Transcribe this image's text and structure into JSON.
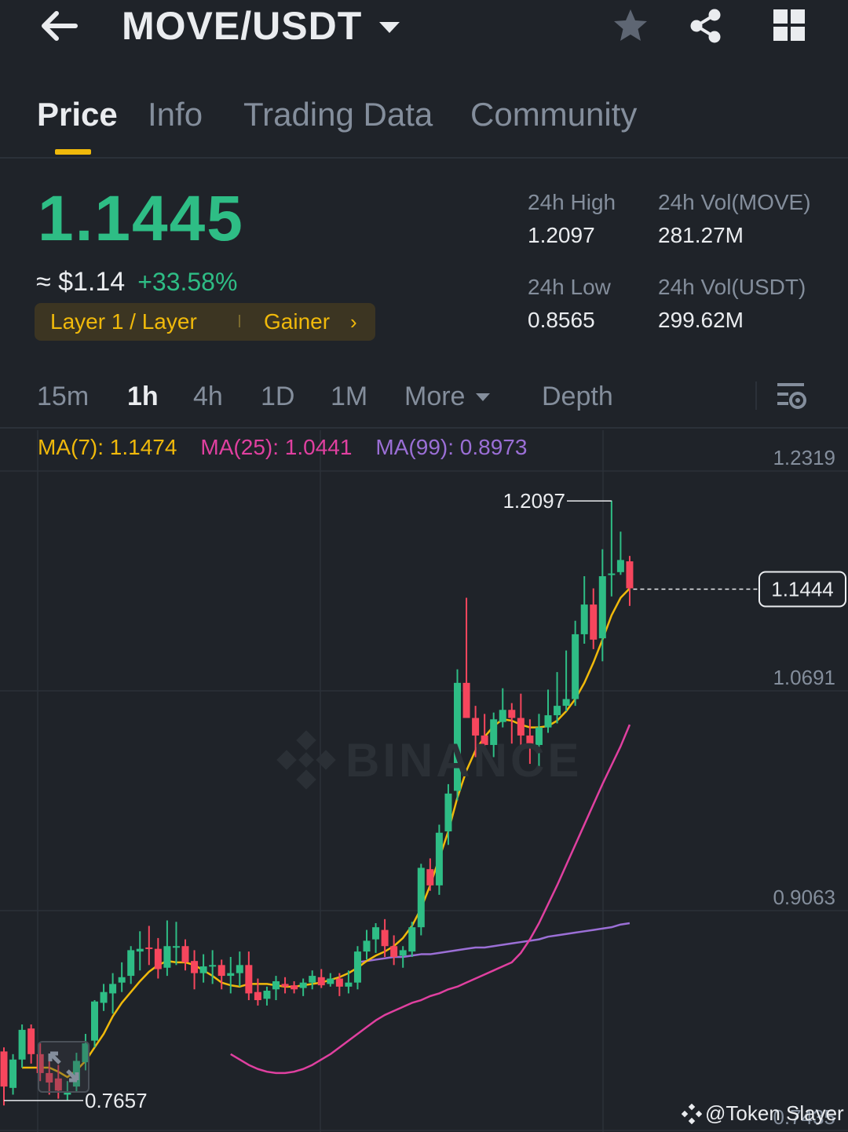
{
  "header": {
    "pair": "MOVE/USDT",
    "icons": {
      "back": "back-arrow-icon",
      "favorite": "star-icon",
      "share": "share-icon",
      "more": "grid-icon"
    }
  },
  "tabs": [
    "Price",
    "Info",
    "Trading Data",
    "Community"
  ],
  "active_tab": "Price",
  "price": {
    "last": "1.1445",
    "usd": "≈ $1.14",
    "change": "+33.58%",
    "tag_category": "Layer 1 / Layer",
    "tag_rank": "Gainer",
    "tag_arrow": "›"
  },
  "stats": {
    "high_label": "24h High",
    "high_value": "1.2097",
    "low_label": "24h Low",
    "low_value": "0.8565",
    "vol_base_label": "24h Vol(MOVE)",
    "vol_base_value": "281.27M",
    "vol_quote_label": "24h Vol(USDT)",
    "vol_quote_value": "299.62M"
  },
  "intervals": [
    "15m",
    "1h",
    "4h",
    "1D",
    "1M"
  ],
  "active_interval": "1h",
  "more_label": "More",
  "depth_label": "Depth",
  "ma": {
    "ma7": "MA(7): 1.1474",
    "ma25": "MA(25): 1.0441",
    "ma99": "MA(99): 0.8973"
  },
  "colors": {
    "up": "#2ebd85",
    "down": "#f6465d",
    "accent": "#f0b90b",
    "ma7": "#f0b90b",
    "ma25": "#e040a0",
    "ma99": "#9b6fd6",
    "background": "#1f2329",
    "muted": "#848e9c"
  },
  "watermark": "BINANCE",
  "credit": "@Token Slayer",
  "chart_data": {
    "type": "candlestick",
    "interval": "1h",
    "y_ticks": [
      "1.2319",
      "1.0691",
      "0.9063",
      "0.7435"
    ],
    "ylim": [
      0.7435,
      1.2319
    ],
    "current_price_label": "1.1444",
    "current_price": 1.1444,
    "high_label": "1.2097",
    "high": 1.2097,
    "low_label": "0.7657",
    "low": 0.7657,
    "candles": [
      {
        "o": 0.802,
        "h": 0.805,
        "l": 0.762,
        "c": 0.776
      },
      {
        "o": 0.775,
        "h": 0.8,
        "l": 0.77,
        "c": 0.796
      },
      {
        "o": 0.796,
        "h": 0.822,
        "l": 0.79,
        "c": 0.818
      },
      {
        "o": 0.819,
        "h": 0.822,
        "l": 0.793,
        "c": 0.8
      },
      {
        "o": 0.8,
        "h": 0.808,
        "l": 0.78,
        "c": 0.786
      },
      {
        "o": 0.786,
        "h": 0.8,
        "l": 0.77,
        "c": 0.779
      },
      {
        "o": 0.782,
        "h": 0.792,
        "l": 0.767,
        "c": 0.773
      },
      {
        "o": 0.77,
        "h": 0.78,
        "l": 0.7657,
        "c": 0.772
      },
      {
        "o": 0.776,
        "h": 0.801,
        "l": 0.772,
        "c": 0.795
      },
      {
        "o": 0.794,
        "h": 0.815,
        "l": 0.788,
        "c": 0.808
      },
      {
        "o": 0.81,
        "h": 0.84,
        "l": 0.805,
        "c": 0.839
      },
      {
        "o": 0.838,
        "h": 0.852,
        "l": 0.832,
        "c": 0.846
      },
      {
        "o": 0.845,
        "h": 0.86,
        "l": 0.83,
        "c": 0.852
      },
      {
        "o": 0.853,
        "h": 0.868,
        "l": 0.846,
        "c": 0.857
      },
      {
        "o": 0.858,
        "h": 0.88,
        "l": 0.852,
        "c": 0.877
      },
      {
        "o": 0.876,
        "h": 0.891,
        "l": 0.862,
        "c": 0.878
      },
      {
        "o": 0.879,
        "h": 0.895,
        "l": 0.866,
        "c": 0.878
      },
      {
        "o": 0.878,
        "h": 0.886,
        "l": 0.856,
        "c": 0.863
      },
      {
        "o": 0.864,
        "h": 0.899,
        "l": 0.858,
        "c": 0.88
      },
      {
        "o": 0.88,
        "h": 0.898,
        "l": 0.866,
        "c": 0.88
      },
      {
        "o": 0.88,
        "h": 0.885,
        "l": 0.862,
        "c": 0.868
      },
      {
        "o": 0.869,
        "h": 0.877,
        "l": 0.848,
        "c": 0.86
      },
      {
        "o": 0.86,
        "h": 0.874,
        "l": 0.853,
        "c": 0.865
      },
      {
        "o": 0.866,
        "h": 0.877,
        "l": 0.852,
        "c": 0.866
      },
      {
        "o": 0.866,
        "h": 0.87,
        "l": 0.848,
        "c": 0.858
      },
      {
        "o": 0.858,
        "h": 0.872,
        "l": 0.845,
        "c": 0.86
      },
      {
        "o": 0.86,
        "h": 0.876,
        "l": 0.85,
        "c": 0.866
      },
      {
        "o": 0.866,
        "h": 0.876,
        "l": 0.84,
        "c": 0.845
      },
      {
        "o": 0.846,
        "h": 0.856,
        "l": 0.836,
        "c": 0.84
      },
      {
        "o": 0.841,
        "h": 0.85,
        "l": 0.836,
        "c": 0.847
      },
      {
        "o": 0.848,
        "h": 0.858,
        "l": 0.84,
        "c": 0.854
      },
      {
        "o": 0.852,
        "h": 0.857,
        "l": 0.845,
        "c": 0.85
      },
      {
        "o": 0.851,
        "h": 0.854,
        "l": 0.845,
        "c": 0.848
      },
      {
        "o": 0.849,
        "h": 0.856,
        "l": 0.843,
        "c": 0.853
      },
      {
        "o": 0.853,
        "h": 0.862,
        "l": 0.848,
        "c": 0.858
      },
      {
        "o": 0.857,
        "h": 0.863,
        "l": 0.849,
        "c": 0.851
      },
      {
        "o": 0.852,
        "h": 0.86,
        "l": 0.85,
        "c": 0.856
      },
      {
        "o": 0.856,
        "h": 0.86,
        "l": 0.843,
        "c": 0.85
      },
      {
        "o": 0.85,
        "h": 0.862,
        "l": 0.845,
        "c": 0.853
      },
      {
        "o": 0.853,
        "h": 0.88,
        "l": 0.848,
        "c": 0.876
      },
      {
        "o": 0.876,
        "h": 0.892,
        "l": 0.87,
        "c": 0.884
      },
      {
        "o": 0.885,
        "h": 0.897,
        "l": 0.875,
        "c": 0.894
      },
      {
        "o": 0.892,
        "h": 0.9,
        "l": 0.872,
        "c": 0.88
      },
      {
        "o": 0.88,
        "h": 0.888,
        "l": 0.866,
        "c": 0.872
      },
      {
        "o": 0.873,
        "h": 0.88,
        "l": 0.864,
        "c": 0.877
      },
      {
        "o": 0.876,
        "h": 0.898,
        "l": 0.872,
        "c": 0.894
      },
      {
        "o": 0.894,
        "h": 0.941,
        "l": 0.888,
        "c": 0.938
      },
      {
        "o": 0.937,
        "h": 0.945,
        "l": 0.921,
        "c": 0.925
      },
      {
        "o": 0.925,
        "h": 0.97,
        "l": 0.918,
        "c": 0.964
      },
      {
        "o": 0.965,
        "h": 1.0,
        "l": 0.955,
        "c": 0.993
      },
      {
        "o": 0.995,
        "h": 1.085,
        "l": 0.988,
        "c": 1.075
      },
      {
        "o": 1.075,
        "h": 1.138,
        "l": 1.05,
        "c": 1.049
      },
      {
        "o": 1.049,
        "h": 1.058,
        "l": 1.02,
        "c": 1.036
      },
      {
        "o": 1.036,
        "h": 1.052,
        "l": 1.023,
        "c": 1.029
      },
      {
        "o": 1.029,
        "h": 1.053,
        "l": 1.02,
        "c": 1.048
      },
      {
        "o": 1.046,
        "h": 1.071,
        "l": 1.042,
        "c": 1.055
      },
      {
        "o": 1.055,
        "h": 1.06,
        "l": 1.03,
        "c": 1.049
      },
      {
        "o": 1.049,
        "h": 1.067,
        "l": 1.029,
        "c": 1.036
      },
      {
        "o": 1.036,
        "h": 1.048,
        "l": 1.015,
        "c": 1.029
      },
      {
        "o": 1.029,
        "h": 1.052,
        "l": 1.009,
        "c": 1.042
      },
      {
        "o": 1.042,
        "h": 1.07,
        "l": 1.038,
        "c": 1.051
      },
      {
        "o": 1.051,
        "h": 1.083,
        "l": 1.045,
        "c": 1.058
      },
      {
        "o": 1.058,
        "h": 1.099,
        "l": 1.054,
        "c": 1.063
      },
      {
        "o": 1.063,
        "h": 1.121,
        "l": 1.058,
        "c": 1.111
      },
      {
        "o": 1.111,
        "h": 1.154,
        "l": 1.104,
        "c": 1.133
      },
      {
        "o": 1.133,
        "h": 1.145,
        "l": 1.1,
        "c": 1.107
      },
      {
        "o": 1.108,
        "h": 1.174,
        "l": 1.091,
        "c": 1.154
      },
      {
        "o": 1.156,
        "h": 1.21,
        "l": 1.139,
        "c": 1.156
      },
      {
        "o": 1.157,
        "h": 1.187,
        "l": 1.155,
        "c": 1.166
      },
      {
        "o": 1.165,
        "h": 1.169,
        "l": 1.132,
        "c": 1.145
      }
    ],
    "ma7_values": [
      0.79,
      0.79,
      0.79,
      0.79,
      0.787,
      0.783,
      0.788,
      0.795,
      0.805,
      0.815,
      0.828,
      0.838,
      0.846,
      0.854,
      0.861,
      0.866,
      0.869,
      0.868,
      0.868,
      0.866,
      0.862,
      0.858,
      0.853,
      0.851,
      0.85,
      0.852,
      0.852,
      0.852,
      0.851,
      0.85,
      0.85,
      0.851,
      0.852,
      0.853,
      0.855,
      0.857,
      0.86,
      0.864,
      0.869,
      0.873,
      0.876,
      0.88,
      0.886,
      0.895,
      0.908,
      0.925,
      0.945,
      0.965,
      0.99,
      1.01,
      1.025,
      1.035,
      1.043,
      1.048,
      1.047,
      1.044,
      1.042,
      1.042,
      1.043,
      1.047,
      1.054,
      1.063,
      1.075,
      1.09,
      1.107,
      1.125,
      1.138,
      1.145
    ],
    "ma25_values": [
      0.8,
      0.796,
      0.792,
      0.789,
      0.787,
      0.786,
      0.786,
      0.787,
      0.789,
      0.792,
      0.796,
      0.8,
      0.805,
      0.81,
      0.815,
      0.82,
      0.825,
      0.829,
      0.832,
      0.835,
      0.838,
      0.84,
      0.843,
      0.845,
      0.848,
      0.85,
      0.853,
      0.856,
      0.859,
      0.862,
      0.865,
      0.868,
      0.875,
      0.885,
      0.897,
      0.911,
      0.925,
      0.94,
      0.955,
      0.97,
      0.985,
      1.0,
      1.014,
      1.028,
      1.044
    ],
    "ma99_values": [
      0.868,
      0.869,
      0.87,
      0.871,
      0.872,
      0.872,
      0.873,
      0.874,
      0.874,
      0.875,
      0.876,
      0.877,
      0.878,
      0.879,
      0.879,
      0.88,
      0.881,
      0.882,
      0.883,
      0.884,
      0.885,
      0.887,
      0.888,
      0.889,
      0.89,
      0.891,
      0.892,
      0.893,
      0.894,
      0.896,
      0.897
    ]
  }
}
